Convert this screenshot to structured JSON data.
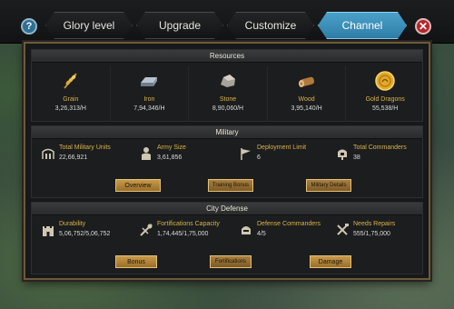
{
  "tabs": [
    {
      "label": "Glory level"
    },
    {
      "label": "Upgrade"
    },
    {
      "label": "Customize"
    },
    {
      "label": "Channel",
      "active": true
    }
  ],
  "icons": {
    "help": "?",
    "close": "✕"
  },
  "resources": {
    "title": "Resources",
    "items": [
      {
        "name": "Grain",
        "value": "3,26,313/H",
        "icon": "grain-icon"
      },
      {
        "name": "Iron",
        "value": "7,94,346/H",
        "icon": "iron-icon"
      },
      {
        "name": "Stone",
        "value": "8,90,060/H",
        "icon": "stone-icon"
      },
      {
        "name": "Wood",
        "value": "3,95,140/H",
        "icon": "wood-icon"
      },
      {
        "name": "Gold Dragons",
        "value": "55,538/H",
        "icon": "gold-dragons-icon"
      }
    ]
  },
  "military": {
    "title": "Military",
    "stats": [
      {
        "label": "Total Military Units",
        "value": "22,66,921",
        "icon": "military-units-icon"
      },
      {
        "label": "Army Size",
        "value": "3,61,856",
        "icon": "army-size-icon"
      },
      {
        "label": "Deployment Limit",
        "value": "6",
        "icon": "deployment-limit-icon"
      },
      {
        "label": "Total Commanders",
        "value": "38",
        "icon": "commanders-icon"
      }
    ],
    "buttons": {
      "overview": "Overview",
      "training": "Training Bonus",
      "details": "Military Details"
    }
  },
  "city_defense": {
    "title": "City Defense",
    "stats": [
      {
        "label": "Durability",
        "value": "5,06,752/5,06,752",
        "icon": "castle-icon"
      },
      {
        "label": "Fortifications Capacity",
        "value": "1,74,445/1,75,000",
        "icon": "fortifications-icon"
      },
      {
        "label": "Defense Commanders",
        "value": "4/5",
        "icon": "helmet-icon"
      },
      {
        "label": "Needs Repairs",
        "value": "555/1,75,000",
        "icon": "repair-icon"
      }
    ],
    "buttons": {
      "bonus": "Bonus",
      "fortifications": "Fortifications",
      "damage": "Damage"
    }
  }
}
